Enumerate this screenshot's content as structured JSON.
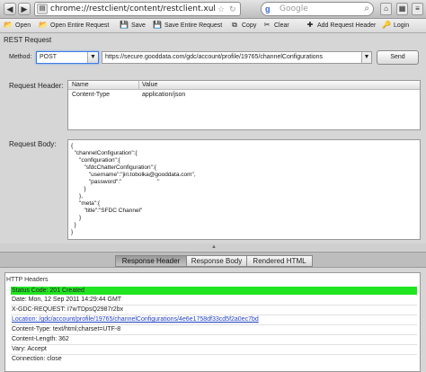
{
  "browser": {
    "url": "chrome://restclient/content/restclient.xul",
    "search_placeholder": "Google",
    "search_logo": "g"
  },
  "toolbar": {
    "items": [
      {
        "label": "Open"
      },
      {
        "label": "Open Entire Request"
      },
      {
        "label": "Save"
      },
      {
        "label": "Save Entire Request"
      },
      {
        "label": "Copy"
      },
      {
        "label": "Clear"
      },
      {
        "label": "Add Request Header"
      },
      {
        "label": "Login"
      }
    ]
  },
  "request": {
    "title": "REST Request",
    "method_label": "Method:",
    "method_value": "POST",
    "url_value": "https://secure.gooddata.com/gdc/account/profile/19765/channelConfigurations",
    "send_label": "Send",
    "header_label": "Request Header:",
    "header_columns": [
      "Name",
      "Value"
    ],
    "headers": [
      {
        "name": "Content-Type",
        "value": "application/json"
      }
    ],
    "body_label": "Request Body:",
    "body_lines": [
      "{",
      "  \"channelConfiguration\":{",
      "     \"configuration\":{",
      "        \"sfdcChatterConfiguration\":{",
      "           \"username\":\"jiri.tobolka@gooddata.com\",",
      "           \"password\":\"                      \"",
      "        }",
      "     },",
      "     \"meta\":{",
      "        \"title\":\"SFDC Channel\"",
      "     }",
      "  }",
      "}"
    ]
  },
  "response": {
    "tabs": [
      {
        "label": "Response Header",
        "active": true
      },
      {
        "label": "Response Body",
        "active": false
      },
      {
        "label": "Rendered HTML",
        "active": false
      }
    ],
    "panel_title": "HTTP Headers",
    "status": "Status Code: 201 Created",
    "lines": [
      "Date: Mon, 12 Sep 2011 14:29:44 GMT",
      "X-GDC-REQUEST: I7wTDpsQ2987r2bx",
      "Location: /gdc/account/profile/19765/channelConfigurations/4e6e1758df33cd5f2a0ec7bd",
      "Content-Type: text/html;charset=UTF-8",
      "Content-Length: 362",
      "Vary: Accept",
      "Connection: close"
    ]
  },
  "colors": {
    "status_ok": "#22e522",
    "link": "#1f3fc4",
    "focus": "#3d7be6"
  }
}
